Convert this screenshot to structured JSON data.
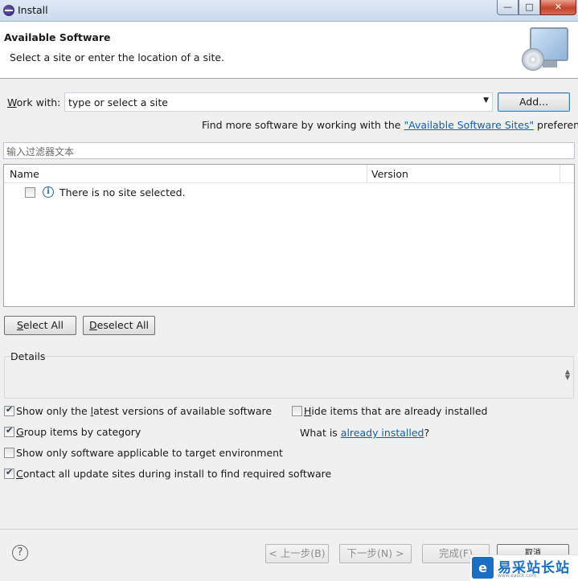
{
  "window": {
    "title": "Install",
    "min_glyph": "—",
    "max_glyph": "□",
    "close_glyph": "✕"
  },
  "header": {
    "title": "Available Software",
    "subtitle": "Select a site or enter the location of a site."
  },
  "work_with": {
    "label_pre": "",
    "label_mnemonic": "W",
    "label_post": "ork with:",
    "combo_value": "type or select a site",
    "combo_arrow": "▼",
    "add_button": "Add..."
  },
  "find_more": {
    "prefix": "Find more software by working with the ",
    "link": "\"Available Software Sites\"",
    "suffix": " preferences."
  },
  "filter": {
    "placeholder": "输入过滤器文本"
  },
  "table": {
    "columns": [
      "Name",
      "Version"
    ],
    "rows": [
      {
        "checked": false,
        "icon": "info-icon",
        "icon_glyph": "i",
        "text": "There is no site selected."
      }
    ]
  },
  "buttons": {
    "select_all_mnemonic": "S",
    "select_all_rest": "elect All",
    "deselect_all_mnemonic": "D",
    "deselect_all_rest": "eselect All"
  },
  "details": {
    "label": "Details",
    "scroll_glyph": "▲\n▼"
  },
  "options": {
    "latest": {
      "checked": true,
      "pre": "Show only the ",
      "mn": "l",
      "post": "atest versions of available software"
    },
    "group": {
      "checked": true,
      "pre": "",
      "mn": "G",
      "post": "roup items by category"
    },
    "applicable": {
      "checked": false,
      "pre": "Show only software applicable to target environment",
      "mn": "",
      "post": ""
    },
    "contact": {
      "checked": true,
      "pre": "",
      "mn": "C",
      "post": "ontact all update sites during install to find required software"
    },
    "hide": {
      "checked": false,
      "pre": "",
      "mn": "H",
      "post": "ide items that are already installed"
    }
  },
  "what_is": {
    "prefix": "What is ",
    "link": "already installed",
    "suffix": "?"
  },
  "footer": {
    "help_glyph": "?",
    "back": "< 上一步(B)",
    "next": "下一步(N) >",
    "finish": "完成(F)",
    "cancel": "取消"
  },
  "watermark": {
    "logo": "e",
    "text": "易采站长站",
    "small": "www.easck.com"
  }
}
